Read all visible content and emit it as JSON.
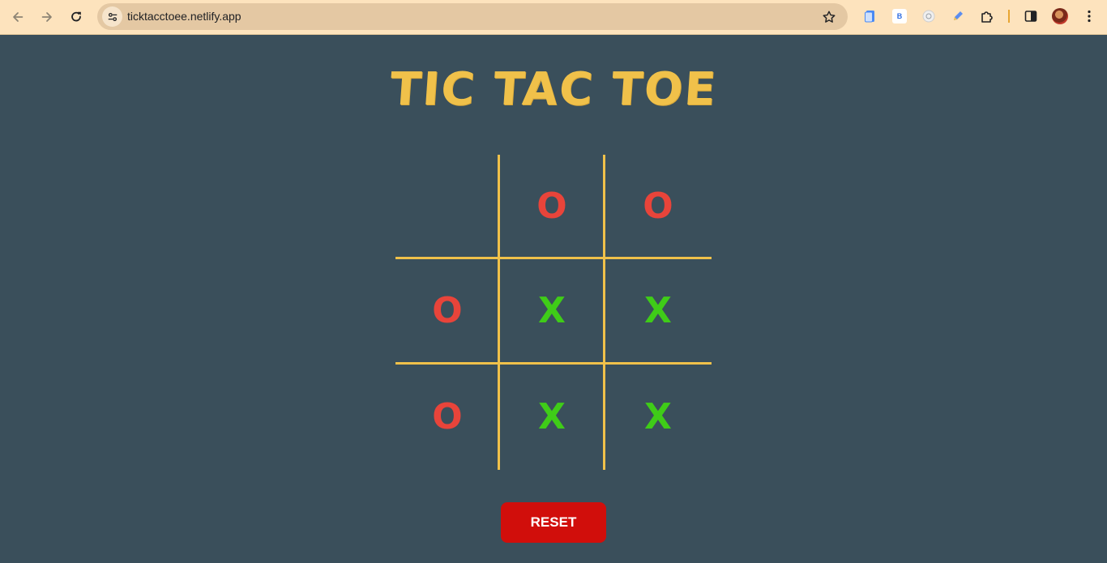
{
  "browser": {
    "url": "ticktacctoee.netlify.app",
    "icons": {
      "back": "back-arrow-icon",
      "forward": "forward-arrow-icon",
      "reload": "reload-icon",
      "site_info": "site-settings-icon",
      "bookmark": "star-icon",
      "extensions": [
        "document-extension-icon",
        "b-extension-icon",
        "circle-extension-icon",
        "pen-extension-icon",
        "puzzle-icon"
      ],
      "side_panel": "side-panel-icon",
      "profile": "avatar",
      "menu": "more-vert-icon"
    },
    "ext_b_label": "B"
  },
  "game": {
    "title": "TIC TAC TOE",
    "board": [
      [
        "",
        "O",
        "O"
      ],
      [
        "O",
        "X",
        "X"
      ],
      [
        "O",
        "X",
        "X"
      ]
    ],
    "reset_label": "RESET"
  },
  "colors": {
    "background": "#3a4f5b",
    "accent": "#f0c14a",
    "o_mark": "#e8443a",
    "x_mark": "#3fcc18",
    "reset_button": "#d10e0b",
    "chrome_bar": "#fde3bd"
  }
}
